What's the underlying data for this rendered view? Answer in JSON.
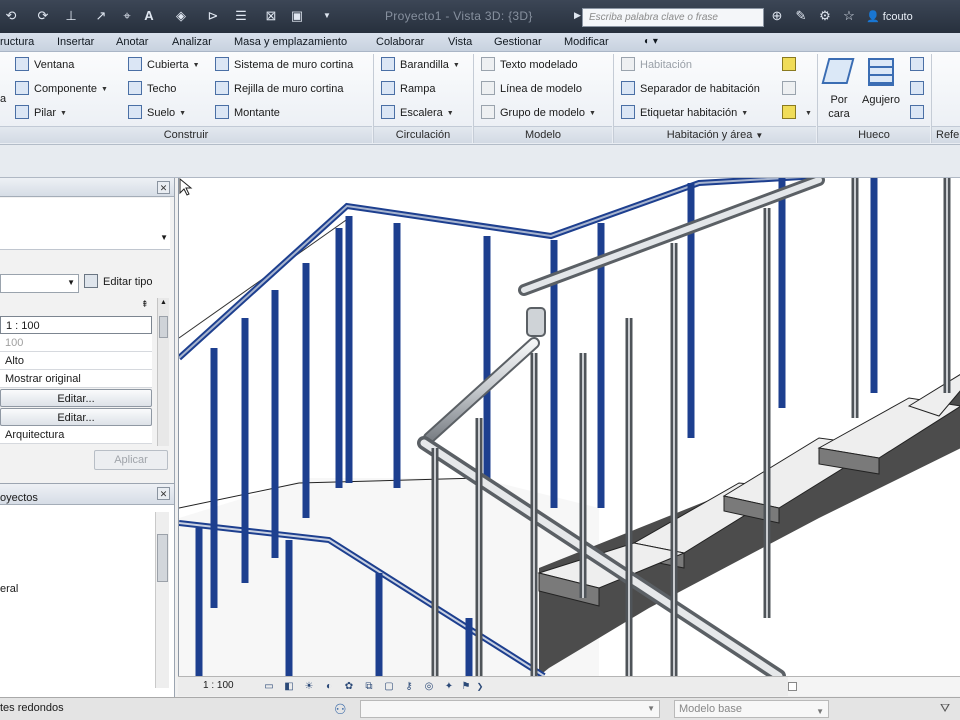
{
  "titlebar": {
    "project_title": "Proyecto1 - Vista 3D: {3D}",
    "search_placeholder": "Escriba palabra clave o frase",
    "user": "fcouto"
  },
  "tabs": [
    {
      "label": "ructura"
    },
    {
      "label": "Insertar"
    },
    {
      "label": "Anotar"
    },
    {
      "label": "Analizar"
    },
    {
      "label": "Masa y emplazamiento"
    },
    {
      "label": "Colaborar"
    },
    {
      "label": "Vista"
    },
    {
      "label": "Gestionar"
    },
    {
      "label": "Modificar"
    }
  ],
  "ribbon": {
    "construir": {
      "title": "Construir",
      "partial_label": "a",
      "items": [
        "Ventana",
        "Componente",
        "Pilar",
        "Cubierta",
        "Techo",
        "Suelo",
        "Sistema de muro cortina",
        "Rejilla de muro cortina",
        "Montante"
      ]
    },
    "circulacion": {
      "title": "Circulación",
      "items": [
        "Barandilla",
        "Rampa",
        "Escalera"
      ]
    },
    "modelo": {
      "title": "Modelo",
      "items": [
        "Texto modelado",
        "Línea de modelo",
        "Grupo de modelo"
      ]
    },
    "habitacion": {
      "title": "Habitación y área",
      "items": [
        "Habitación",
        "Separador de habitación",
        "Etiquetar habitación"
      ]
    },
    "hueco": {
      "title": "Hueco",
      "por_cara_1": "Por",
      "por_cara_2": "cara",
      "agujero": "Agujero"
    },
    "ref_title": "Refe"
  },
  "properties": {
    "edit_type": "Editar tipo",
    "rows": [
      {
        "value": "1 : 100"
      },
      {
        "value": "100"
      },
      {
        "value": "Alto"
      },
      {
        "value": "Mostrar original"
      },
      {
        "value": "Editar..."
      },
      {
        "value": "Editar..."
      },
      {
        "value": "Arquitectura"
      }
    ],
    "apply": "Aplicar"
  },
  "browser": {
    "title": "oyectos",
    "item": "eral"
  },
  "viewbar": {
    "scale": "1 : 100"
  },
  "status": {
    "text": "tes redondos",
    "model": "Modelo base"
  },
  "colors": {
    "selection_blue": "#1d3f8f",
    "stair_dark": "#4a4a4a",
    "rail_gray": "#8f959b"
  }
}
